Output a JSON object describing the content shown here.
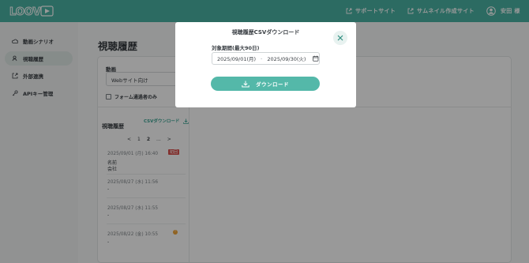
{
  "app": {
    "logo_text": "LOOV"
  },
  "header": {
    "support_label": "サポートサイト",
    "thumbnail_label": "サムネイル作成サイト",
    "user_name": "安田 様"
  },
  "sidebar": {
    "items": [
      {
        "label": "動画シナリオ",
        "icon": "play-cloud-icon",
        "active": false
      },
      {
        "label": "視聴履歴",
        "icon": "user-icon",
        "active": true
      },
      {
        "label": "外部連携",
        "icon": "external-link-icon",
        "active": false
      },
      {
        "label": "APIキー管理",
        "icon": "key-icon",
        "active": false
      }
    ]
  },
  "main": {
    "title": "視聴履歴",
    "video_label": "動画",
    "video_select_value": "Webサイト向け",
    "form_only_label": "フォーム通過者のみ",
    "history_heading": "視聴履歴",
    "csv_download_link": "CSVダウンロード",
    "pagination": {
      "prev": "<",
      "pages": [
        "1",
        "2",
        "..."
      ],
      "next": ">"
    },
    "history": [
      {
        "timestamp": "2025/09/01 (月) 16:40",
        "badge": "初回",
        "lines": [
          "名前",
          "会社"
        ]
      },
      {
        "timestamp": "2025/08/27 (水) 11:56",
        "badge": "",
        "lines": [
          "-"
        ]
      },
      {
        "timestamp": "2025/08/27 (水) 11:55",
        "badge": "",
        "lines": [
          "-"
        ]
      },
      {
        "timestamp": "2025/08/22 (金) 10:55",
        "badge": "!",
        "lines": [
          "-"
        ]
      }
    ]
  },
  "modal": {
    "title": "視聴履歴CSVダウンロード",
    "period_label": "対象期間(最大90日)",
    "start_date": "2025/09/01(月)",
    "separator": "-",
    "end_date": "2025/09/30(火)",
    "download_label": "ダウンロード"
  },
  "colors": {
    "brand": "#4ab3a4",
    "button": "#54b8a9",
    "badge": "#d9534f"
  }
}
